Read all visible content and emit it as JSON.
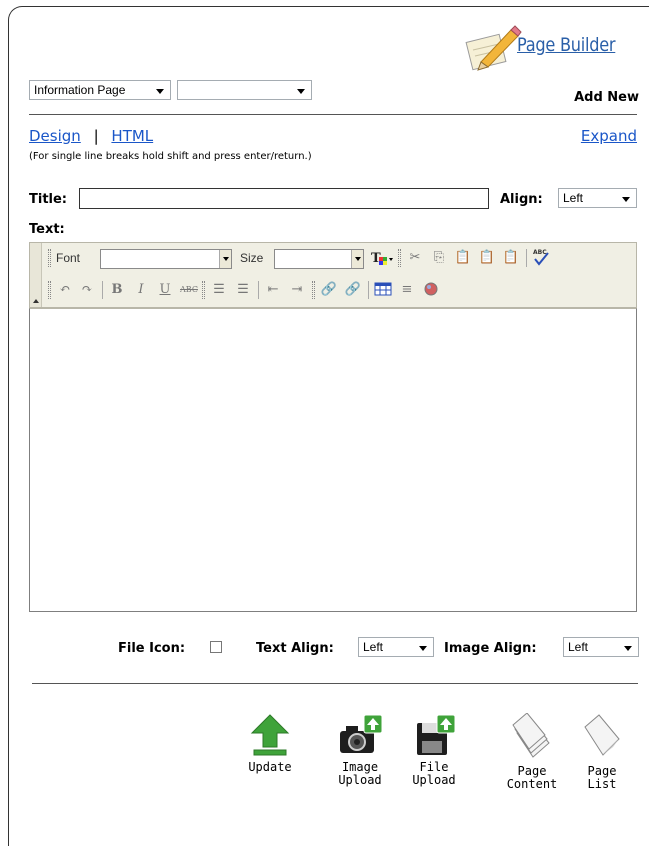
{
  "header": {
    "logo_text": "Page Builder",
    "page_type_select": "Information Page",
    "second_select": "",
    "add_new": "Add New"
  },
  "mode_links": {
    "design": "Design",
    "separator": "|",
    "html": "HTML",
    "expand": "Expand",
    "hint": "(For single line breaks hold shift and press enter/return.)"
  },
  "form": {
    "title_label": "Title:",
    "title_value": "",
    "align_label": "Align:",
    "align_value": "Left",
    "text_label": "Text:"
  },
  "toolbar": {
    "font_label": "Font",
    "font_value": "",
    "size_label": "Size",
    "size_value": ""
  },
  "options": {
    "file_icon_label": "File Icon:",
    "file_icon_checked": false,
    "text_align_label": "Text Align:",
    "text_align_value": "Left",
    "image_align_label": "Image Align:",
    "image_align_value": "Left"
  },
  "actions": [
    {
      "label": "Update",
      "icon": "upload-arrow-icon",
      "color": "#3fa33a"
    },
    {
      "label": "Image\nUpload",
      "icon": "camera-upload-icon"
    },
    {
      "label": "File\nUpload",
      "icon": "floppy-upload-icon"
    },
    {
      "label": "Page\nContent",
      "icon": "page-stack-icon"
    },
    {
      "label": "Page\nList",
      "icon": "page-icon"
    }
  ],
  "colors": {
    "link": "#1a56c8",
    "logo": "#2a5fa8",
    "toolbar_bg": "#f0efe4",
    "upload_green": "#3fa33a"
  }
}
